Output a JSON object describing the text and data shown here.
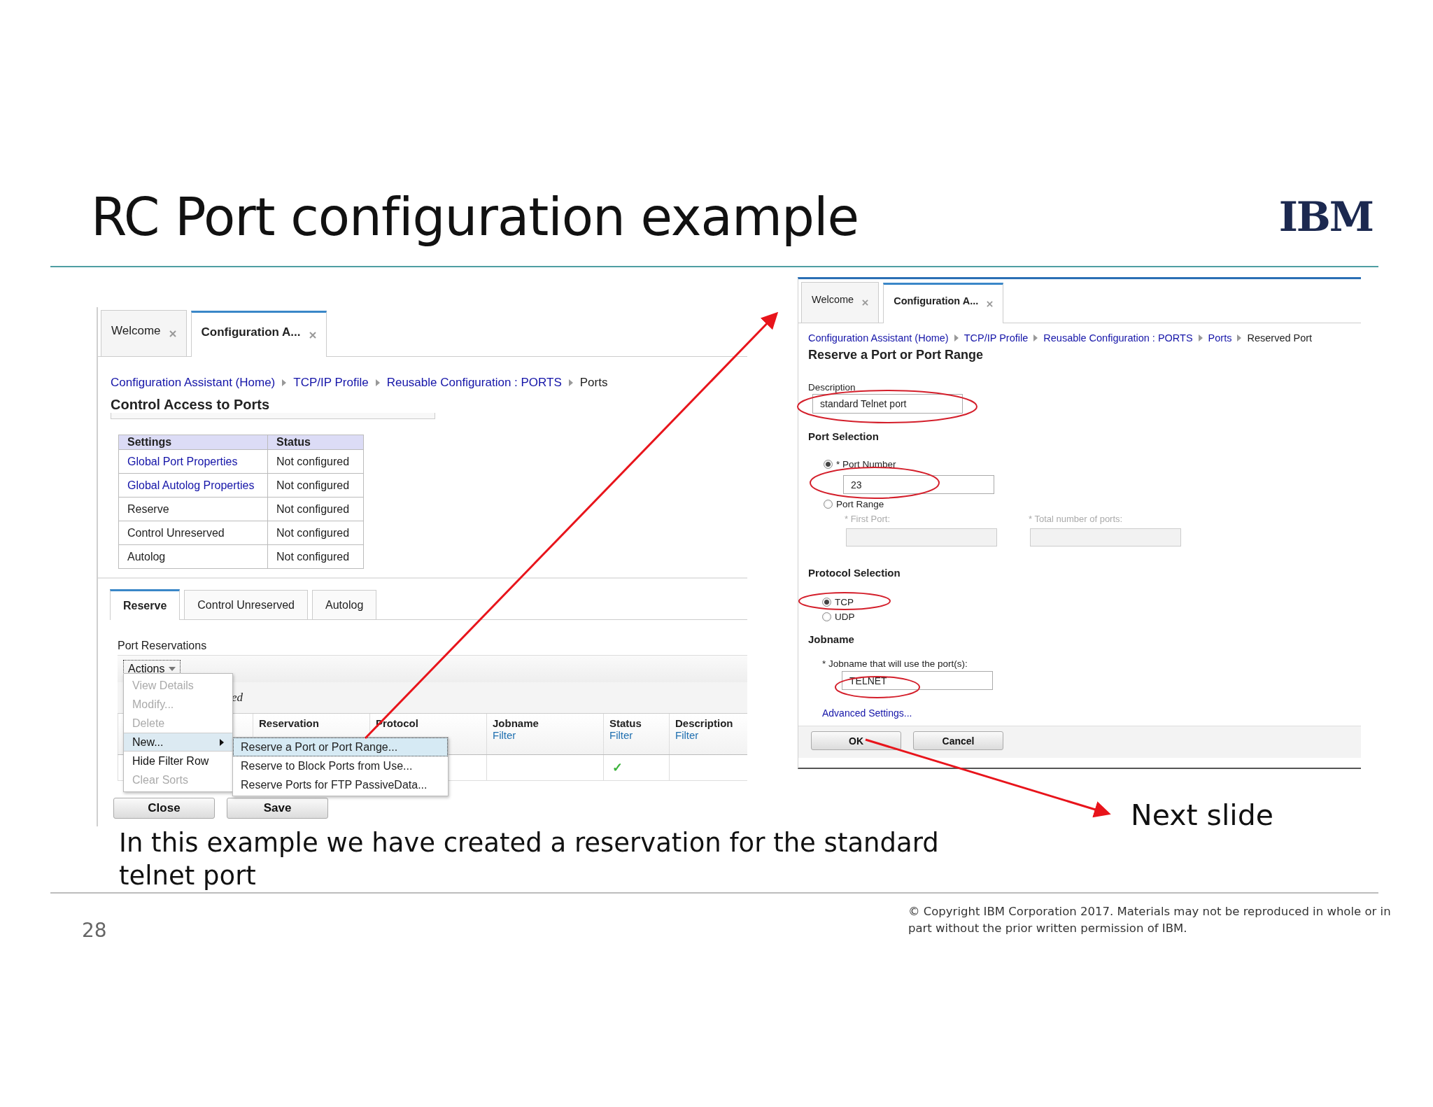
{
  "slide": {
    "title": "RC Port configuration example",
    "logo": "IBM",
    "caption": "In this example we have created a reservation for the standard telnet port",
    "note": "Next slide",
    "page_number": "28",
    "copyright": "© Copyright IBM Corporation 2017.  Materials may not be reproduced in whole or in part without the prior written permission of IBM."
  },
  "left_window": {
    "tabs": [
      {
        "label": "Welcome",
        "selected": false
      },
      {
        "label": "Configuration A...",
        "selected": true
      }
    ],
    "breadcrumb": [
      {
        "label": "Configuration Assistant (Home)",
        "kind": "link"
      },
      {
        "label": "TCP/IP Profile",
        "kind": "link"
      },
      {
        "label": "Reusable Configuration : PORTS",
        "kind": "link"
      },
      {
        "label": "Ports",
        "kind": "current"
      }
    ],
    "heading": "Control Access to Ports",
    "settings_table": {
      "columns": [
        "Settings",
        "Status"
      ],
      "rows": [
        {
          "setting": "Global Port Properties",
          "kind": "link",
          "status": "Not configured"
        },
        {
          "setting": "Global Autolog Properties",
          "kind": "link",
          "status": "Not configured"
        },
        {
          "setting": "Reserve",
          "kind": "text",
          "status": "Not configured"
        },
        {
          "setting": "Control Unreserved",
          "kind": "text",
          "status": "Not configured"
        },
        {
          "setting": "Autolog",
          "kind": "text",
          "status": "Not configured"
        }
      ]
    },
    "subtabs": [
      {
        "label": "Reserve",
        "selected": true
      },
      {
        "label": "Control Unreserved",
        "selected": false
      },
      {
        "label": "Autolog",
        "selected": false
      }
    ],
    "section_label": "Port Reservations",
    "actions_button": "Actions",
    "partial_text": "ed",
    "table": {
      "columns": [
        {},
        {
          "label": "Reservation"
        },
        {
          "label": "Protocol"
        },
        {
          "label": "Jobname",
          "filter": "Filter"
        },
        {
          "label": "Status",
          "filter": "Filter"
        },
        {
          "label": "Description",
          "filter": "Filter"
        }
      ],
      "rows": [
        {
          "status": "✓"
        }
      ]
    },
    "menu": [
      {
        "label": "View Details",
        "disabled": true,
        "selected": false,
        "submenu": false
      },
      {
        "label": "Modify...",
        "disabled": true,
        "selected": false,
        "submenu": false
      },
      {
        "label": "Delete",
        "disabled": true,
        "selected": false,
        "submenu": false
      },
      {
        "label": "New...",
        "disabled": false,
        "selected": true,
        "submenu": true
      },
      {
        "label": "Hide Filter Row",
        "disabled": false,
        "selected": false,
        "submenu": false
      },
      {
        "label": "Clear Sorts",
        "disabled": true,
        "selected": false,
        "submenu": false
      }
    ],
    "submenu": [
      {
        "label": "Reserve a Port or Port Range...",
        "selected": true
      },
      {
        "label": "Reserve to Block Ports from Use...",
        "selected": false
      },
      {
        "label": "Reserve Ports for FTP PassiveData...",
        "selected": false
      }
    ],
    "buttons": [
      "Close",
      "Save"
    ]
  },
  "right_window": {
    "tabs": [
      {
        "label": "Welcome",
        "selected": false
      },
      {
        "label": "Configuration A...",
        "selected": true
      }
    ],
    "breadcrumb": [
      {
        "label": "Configuration Assistant (Home)",
        "kind": "link"
      },
      {
        "label": "TCP/IP Profile",
        "kind": "link"
      },
      {
        "label": "Reusable Configuration : PORTS",
        "kind": "link"
      },
      {
        "label": "Ports",
        "kind": "link"
      },
      {
        "label": "Reserved Port",
        "kind": "current"
      }
    ],
    "heading": "Reserve a Port or Port Range",
    "description": {
      "label": "Description",
      "value": "standard Telnet port"
    },
    "port_selection": {
      "title": "Port Selection",
      "options": [
        {
          "label": "* Port Number",
          "selected": true
        },
        {
          "label": "Port Range",
          "selected": false
        }
      ],
      "port_number": "23",
      "range_fields": [
        {
          "label": "* First Port:",
          "disabled": true
        },
        {
          "label": "* Total number of ports:",
          "disabled": true
        }
      ]
    },
    "protocol": {
      "title": "Protocol Selection",
      "options": [
        {
          "label": "TCP",
          "selected": true
        },
        {
          "label": "UDP",
          "selected": false
        }
      ]
    },
    "jobname": {
      "title": "Jobname",
      "label": "* Jobname that will use the port(s):",
      "value": "TELNET"
    },
    "advanced_link": "Advanced Settings...",
    "buttons": [
      "OK",
      "Cancel"
    ]
  }
}
